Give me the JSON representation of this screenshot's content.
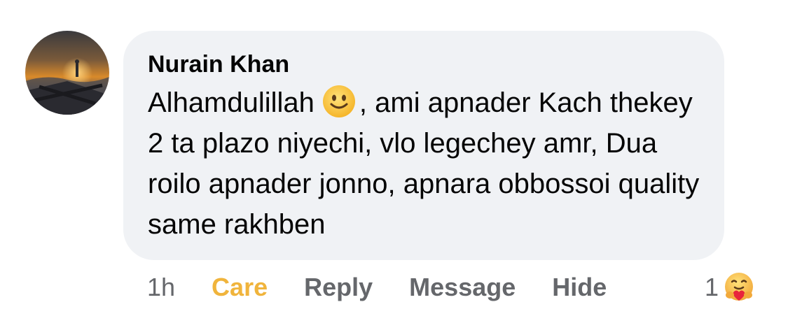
{
  "comment": {
    "author": "Nurain Khan",
    "text_part1": "Alhamdulillah",
    "emoji": "slightly-smiling-face-icon",
    "text_part2": ",  ami apnader Kach thekey 2 ta plazo niyechi, vlo legechey amr, Dua roilo apnader jonno, apnara obbossoi quality same rakhben"
  },
  "actions": {
    "time": "1h",
    "reaction_label": "Care",
    "reply_label": "Reply",
    "message_label": "Message",
    "hide_label": "Hide"
  },
  "reactions": {
    "count": "1",
    "icon": "care-reaction-icon"
  },
  "colors": {
    "bubble_bg": "#f0f2f5",
    "care_accent": "#f0b43c",
    "secondary_text": "#65676b"
  }
}
